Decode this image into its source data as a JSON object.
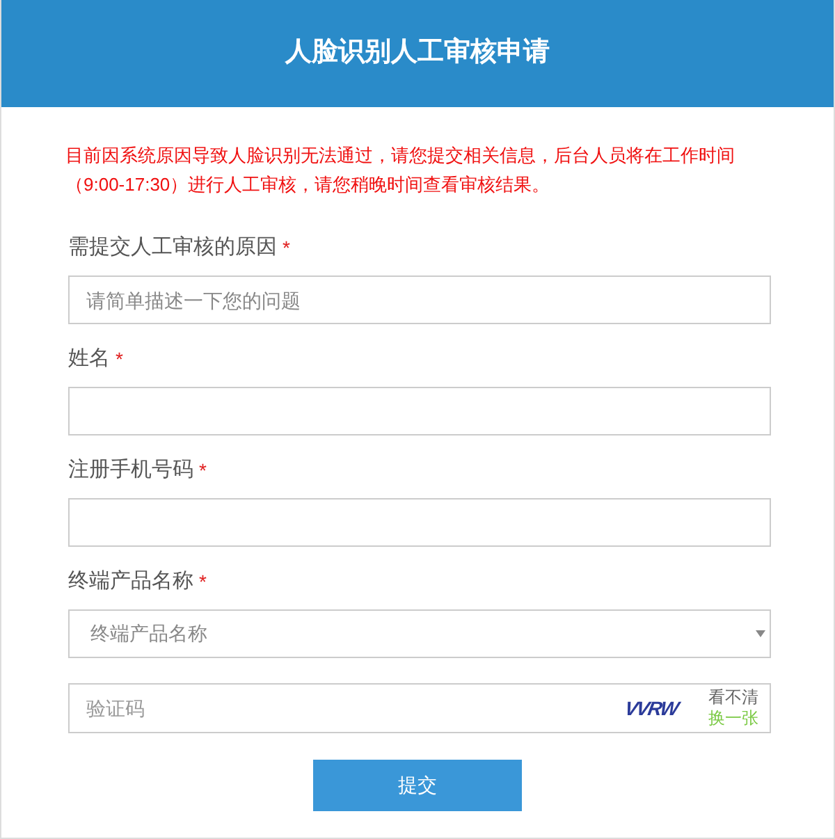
{
  "header": {
    "title": "人脸识别人工审核申请"
  },
  "notice": "目前因系统原因导致人脸识别无法通过，请您提交相关信息，后台人员将在工作时间（9:00-17:30）进行人工审核，请您稍晚时间查看审核结果。",
  "fields": [
    {
      "kind": "text",
      "label": "需提交人工审核的原因",
      "required_mark": "*",
      "placeholder": "请简单描述一下您的问题"
    },
    {
      "kind": "text",
      "label": "姓名",
      "required_mark": "*"
    },
    {
      "kind": "text",
      "label": "注册手机号码",
      "required_mark": "*"
    },
    {
      "kind": "select",
      "label": "终端产品名称",
      "required_mark": "*",
      "placeholder": "终端产品名称"
    }
  ],
  "captcha": {
    "placeholder": "验证码",
    "code": "VVRW",
    "hint": "看不清",
    "refresh": "换一张"
  },
  "submit": "提交"
}
